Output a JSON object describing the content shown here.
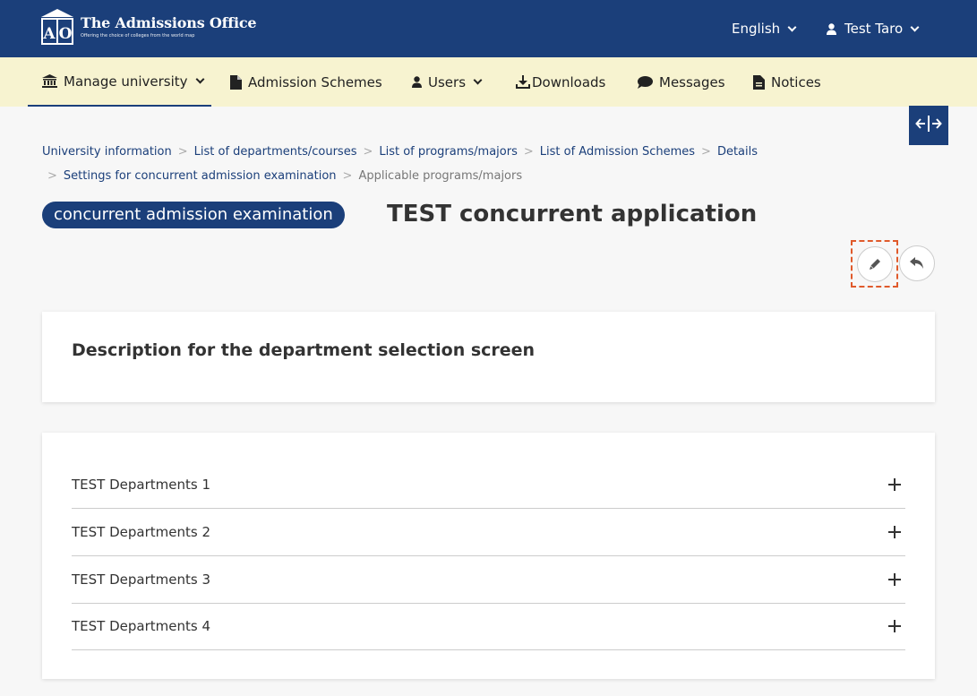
{
  "header": {
    "logo_badge": "AO",
    "logo_title": "The Admissions Office",
    "logo_subtitle": "Offering the choice of colleges from the world map",
    "language": "English",
    "user_name": "Test Taro"
  },
  "nav": {
    "items": [
      {
        "label": "Manage university",
        "icon": "university-icon"
      },
      {
        "label": "Admission Schemes",
        "icon": "document-icon"
      },
      {
        "label": "Users",
        "icon": "user-icon"
      },
      {
        "label": "Downloads",
        "icon": "download-icon"
      },
      {
        "label": "Messages",
        "icon": "chat-icon"
      },
      {
        "label": "Notices",
        "icon": "notice-icon"
      }
    ]
  },
  "breadcrumb": {
    "items": [
      "University information",
      "List of departments/courses",
      "List of programs/majors",
      "List of Admission Schemes",
      "Details",
      "Settings for concurrent admission examination"
    ],
    "current": "Applicable programs/majors",
    "separator": ">"
  },
  "page": {
    "badge": "concurrent admission examination",
    "title": "TEST concurrent application"
  },
  "description_card": {
    "heading": "Description for the department selection screen"
  },
  "departments": [
    "TEST Departments 1",
    "TEST Departments 2",
    "TEST Departments 3",
    "TEST Departments 4"
  ],
  "colors": {
    "primary": "#1b3f7a",
    "nav_bg": "#f7f3d0",
    "highlight": "#e05a2b"
  }
}
